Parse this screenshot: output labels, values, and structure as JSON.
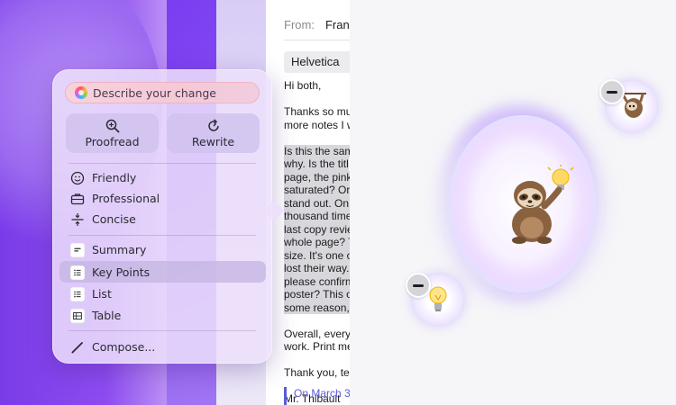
{
  "mail": {
    "from_label": "From:",
    "from_name": "Fran",
    "font_name": "Helvetica",
    "greeting": "Hi both,",
    "para1": [
      "Thanks so muc",
      "more notes I w"
    ],
    "para2": [
      "Is this the sam",
      "why. Is the titl",
      "page, the pinks",
      "saturated? Or",
      "stand out. On p",
      "thousand times",
      "last copy revie",
      "whole page? T",
      "size. It's one o",
      "lost their way. I",
      "please confirm",
      "poster? This o",
      "some reason, t"
    ],
    "para3": [
      "Overall, everyt",
      "work. Print me"
    ],
    "closing": "Thank you, tea",
    "signature": "Mr. Thibault",
    "quote": "On March 31"
  },
  "writing_tools": {
    "describe_placeholder": "Describe your change",
    "proofread_label": "Proofread",
    "rewrite_label": "Rewrite",
    "tone_items": [
      {
        "label": "Friendly",
        "icon": "smile-face-icon"
      },
      {
        "label": "Professional",
        "icon": "briefcase-icon"
      },
      {
        "label": "Concise",
        "icon": "concise-icon"
      }
    ],
    "format_items": [
      {
        "label": "Summary",
        "icon": "summary-icon"
      },
      {
        "label": "Key Points",
        "icon": "key-points-list-icon",
        "selected": true
      },
      {
        "label": "List",
        "icon": "list-icon"
      },
      {
        "label": "Table",
        "icon": "table-icon"
      }
    ],
    "compose_label": "Compose..."
  },
  "playground": {
    "main_emoji": "sloth-holding-lightbulb",
    "bubbles": [
      "sloth-emoji",
      "lightbulb-emoji"
    ]
  },
  "colors": {
    "accent": "#5b5bd6",
    "popover_bg": "#ece0fc",
    "wallpaper_purple": "#7a3ce8"
  }
}
